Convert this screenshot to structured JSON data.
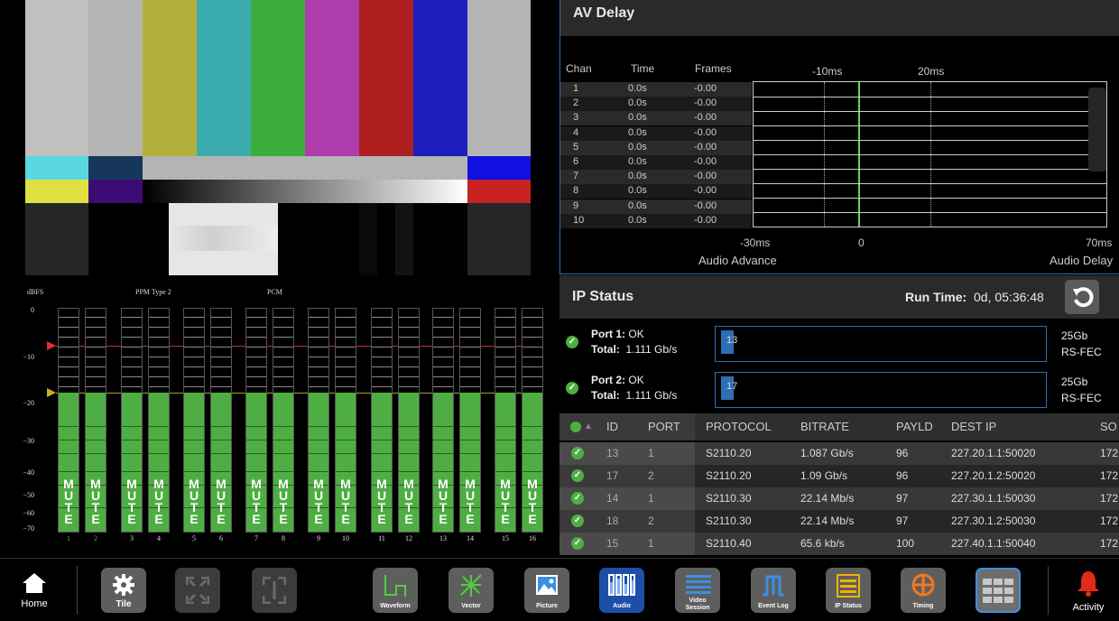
{
  "audio": {
    "unit_label": "dBFS",
    "meter_type": "PPM Type 2",
    "format": "PCM",
    "scale": [
      "0",
      "−10",
      "−20",
      "−30",
      "−40",
      "−50",
      "−60",
      "−70"
    ],
    "mute_text": "MUTE",
    "channels": [
      "1",
      "2",
      "3",
      "4",
      "5",
      "6",
      "7",
      "8",
      "9",
      "10",
      "11",
      "12",
      "13",
      "14",
      "15",
      "16"
    ],
    "level_dbfs": -18,
    "colors": {
      "green": "#4fae43",
      "red_marker": "#e03030",
      "yellow_marker": "#c8b020"
    }
  },
  "av_delay": {
    "title": "AV Delay",
    "columns": {
      "chan": "Chan",
      "time": "Time",
      "frames": "Frames"
    },
    "top_ticks": [
      "-10ms",
      "20ms"
    ],
    "rows": [
      {
        "chan": "1",
        "time": "0.0s",
        "frames": "-0.00"
      },
      {
        "chan": "2",
        "time": "0.0s",
        "frames": "-0.00"
      },
      {
        "chan": "3",
        "time": "0.0s",
        "frames": "-0.00"
      },
      {
        "chan": "4",
        "time": "0.0s",
        "frames": "-0.00"
      },
      {
        "chan": "5",
        "time": "0.0s",
        "frames": "-0.00"
      },
      {
        "chan": "6",
        "time": "0.0s",
        "frames": "-0.00"
      },
      {
        "chan": "7",
        "time": "0.0s",
        "frames": "-0.00"
      },
      {
        "chan": "8",
        "time": "0.0s",
        "frames": "-0.00"
      },
      {
        "chan": "9",
        "time": "0.0s",
        "frames": "-0.00"
      },
      {
        "chan": "10",
        "time": "0.0s",
        "frames": "-0.00"
      }
    ],
    "bottom_ticks": [
      "-30ms",
      "0",
      "70ms"
    ],
    "left_caption": "Audio Advance",
    "right_caption": "Audio Delay"
  },
  "ip_status": {
    "title": "IP Status",
    "run_time_label": "Run Time:",
    "run_time_value": "0d, 05:36:48",
    "ports": [
      {
        "label": "Port 1:",
        "status": "OK",
        "total_label": "Total:",
        "total": "1.111 Gb/s",
        "flow": "13",
        "speed": "25Gb",
        "fec": "RS-FEC"
      },
      {
        "label": "Port 2:",
        "status": "OK",
        "total_label": "Total:",
        "total": "1.111 Gb/s",
        "flow": "17",
        "speed": "25Gb",
        "fec": "RS-FEC"
      }
    ],
    "table": {
      "headers": {
        "id": "ID",
        "port": "PORT",
        "protocol": "PROTOCOL",
        "bitrate": "BITRATE",
        "payload": "PAYLD",
        "dest": "DEST IP",
        "src": "SO"
      },
      "rows": [
        {
          "id": "13",
          "port": "1",
          "protocol": "S2110.20",
          "bitrate": "1.087 Gb/s",
          "payload": "96",
          "dest": "227.20.1.1:50020",
          "src": "172"
        },
        {
          "id": "17",
          "port": "2",
          "protocol": "S2110.20",
          "bitrate": "1.09 Gb/s",
          "payload": "96",
          "dest": "227.20.1.2:50020",
          "src": "172"
        },
        {
          "id": "14",
          "port": "1",
          "protocol": "S2110.30",
          "bitrate": "22.14 Mb/s",
          "payload": "97",
          "dest": "227.30.1.1:50030",
          "src": "172"
        },
        {
          "id": "18",
          "port": "2",
          "protocol": "S2110.30",
          "bitrate": "22.14 Mb/s",
          "payload": "97",
          "dest": "227.30.1.2:50030",
          "src": "172"
        },
        {
          "id": "15",
          "port": "1",
          "protocol": "S2110.40",
          "bitrate": "65.6 kb/s",
          "payload": "100",
          "dest": "227.40.1.1:50040",
          "src": "172"
        }
      ]
    }
  },
  "taskbar": {
    "home": "Home",
    "tile": "Tile",
    "waveform": "Waveform",
    "vector": "Vector",
    "picture": "Picture",
    "audio": "Audio",
    "video_session": "Video Session",
    "event_log": "Event Log",
    "ip_status": "IP Status",
    "timing": "Timing",
    "activity": "Activity"
  }
}
